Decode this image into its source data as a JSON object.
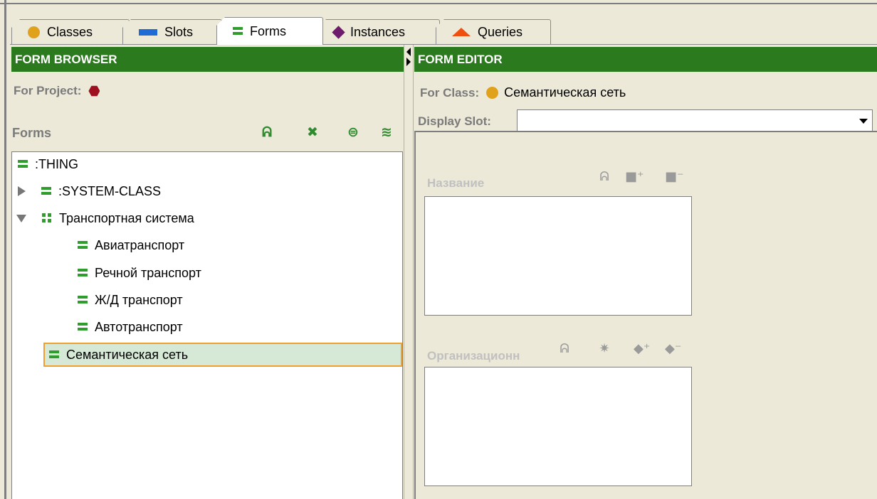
{
  "tabs": [
    {
      "label": "Classes",
      "icon": "class-circle-icon"
    },
    {
      "label": "Slots",
      "icon": "slot-bar-icon"
    },
    {
      "label": "Forms",
      "icon": "form-icon",
      "active": true
    },
    {
      "label": "Instances",
      "icon": "instance-diamond-icon"
    },
    {
      "label": "Queries",
      "icon": "query-triangle-icon"
    }
  ],
  "form_browser": {
    "title": "FORM BROWSER",
    "project_label": "For Project:",
    "forms_label": "Forms",
    "toolbar_icons": [
      "find-form-icon",
      "remove-customization-icon",
      "relayout-icon",
      "layout-like-icon"
    ],
    "tree": [
      {
        "label": ":THING",
        "level": 0,
        "icon": "form-icon"
      },
      {
        "label": ":SYSTEM-CLASS",
        "level": 1,
        "icon": "form-icon",
        "toggle": "collapsed"
      },
      {
        "label": "Транспортная система",
        "level": 1,
        "icon": "form-group-icon",
        "toggle": "expanded"
      },
      {
        "label": "Авиатранспорт",
        "level": 2,
        "icon": "form-icon"
      },
      {
        "label": "Речной транспорт",
        "level": 2,
        "icon": "form-icon"
      },
      {
        "label": "Ж/Д транспорт",
        "level": 2,
        "icon": "form-icon"
      },
      {
        "label": "Автотранспорт",
        "level": 2,
        "icon": "form-icon"
      },
      {
        "label": "Семантическая сеть",
        "level": 1,
        "icon": "form-icon",
        "selected": true
      }
    ]
  },
  "form_editor": {
    "title": "FORM EDITOR",
    "class_label": "For Class:",
    "class_name": "Семантическая сеть",
    "display_slot_label": "Display Slot:",
    "display_slot_value": "",
    "fields": [
      {
        "label": "Название",
        "icons": [
          "find-instance-icon",
          "create-instance-icon",
          "remove-instance-icon"
        ]
      },
      {
        "label": "Организационн",
        "icons": [
          "find-instance-icon",
          "select-instance-icon",
          "add-instance-icon",
          "remove-instance-icon"
        ]
      }
    ]
  },
  "colors": {
    "header_green": "#2b7a1e",
    "background": "#ece9d8",
    "selection_fill": "#d6e8d6",
    "selection_border": "#f0a030"
  }
}
